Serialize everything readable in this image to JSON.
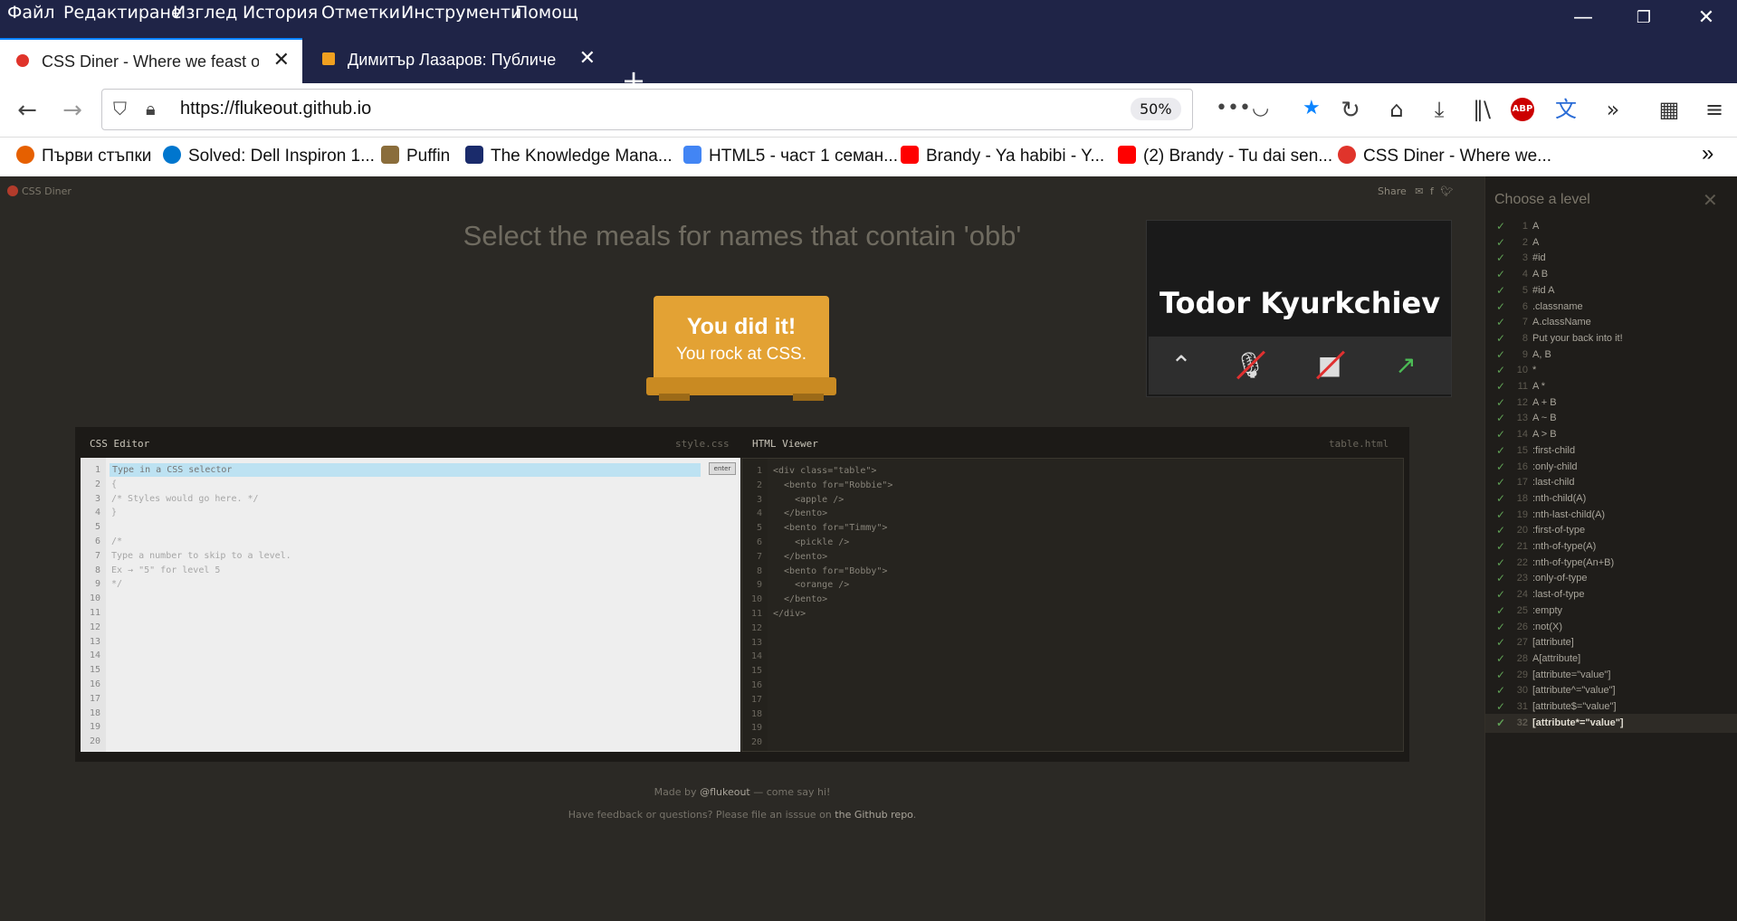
{
  "menubar": {
    "items": [
      "Файл",
      "Редактиране",
      "Изглед",
      "История",
      "Отметки",
      "Инструменти",
      "Помощ"
    ],
    "window_controls": [
      "—",
      "❐",
      "✕"
    ]
  },
  "tabs": [
    {
      "title": "CSS Diner - Where we feast on",
      "active": true
    },
    {
      "title": "Димитър Лазаров: Публичен",
      "active": false
    }
  ],
  "navbar": {
    "url": "https://flukeout.github.io",
    "zoom": "50%"
  },
  "bookmarks": [
    {
      "label": "Първи стъпки",
      "color": "#e66000"
    },
    {
      "label": "Solved: Dell Inspiron 1...",
      "color": "#0076ce"
    },
    {
      "label": "Puffin",
      "color": "#8a6d3b"
    },
    {
      "label": "The Knowledge Mana...",
      "color": "#1a2b6b"
    },
    {
      "label": "HTML5 - част 1 семан...",
      "color": "#4285f4"
    },
    {
      "label": "Brandy - Ya habibi - Y...",
      "color": "#ff0000"
    },
    {
      "label": "(2) Brandy - Tu dai sen...",
      "color": "#ff0000"
    },
    {
      "label": "CSS Diner - Where we...",
      "color": "#e0342b"
    }
  ],
  "page": {
    "logo": "CSS Diner",
    "share": "Share",
    "instruction": "Select the meals for names that contain 'obb'",
    "success_title": "You did it!",
    "success_sub": "You rock at CSS.",
    "video_name": "Todor Kyurkchiev",
    "css_editor_title": "CSS Editor",
    "css_editor_file": "style.css",
    "html_viewer_title": "HTML Viewer",
    "html_viewer_file": "table.html",
    "css_placeholder": "Type in a CSS selector",
    "enter_label": "enter",
    "footer_made_by": "Made by",
    "footer_author": "@flukeout",
    "footer_say_hi": "— come say hi!",
    "footer_feedback": "Have feedback or questions? Please file an isssue on",
    "footer_repo": "the Github repo",
    "footer_period": "."
  },
  "css_code": [
    "",
    "{",
    "/* Styles would go here. */",
    "}",
    "",
    "/*",
    "Type a number to skip to a level.",
    "Ex → \"5\" for level 5",
    "*/",
    "",
    "",
    "",
    "",
    "",
    "",
    "",
    "",
    "",
    "",
    ""
  ],
  "html_code": [
    "<div class=\"table\">",
    "  <bento for=\"Robbie\">",
    "    <apple />",
    "  </bento>",
    "  <bento for=\"Timmy\">",
    "    <pickle />",
    "  </bento>",
    "  <bento for=\"Bobby\">",
    "    <orange />",
    "  </bento>",
    "</div>",
    "",
    "",
    "",
    "",
    "",
    "",
    "",
    "",
    ""
  ],
  "levels_panel": {
    "title": "Choose a level",
    "levels": [
      "A",
      "A",
      "#id",
      "A B",
      "#id A",
      ".classname",
      "A.className",
      "Put your back into it!",
      "A, B",
      "*",
      "A *",
      "A + B",
      "A ~ B",
      "A > B",
      ":first-child",
      ":only-child",
      ":last-child",
      ":nth-child(A)",
      ":nth-last-child(A)",
      ":first-of-type",
      ":nth-of-type(A)",
      ":nth-of-type(An+B)",
      ":only-of-type",
      ":last-of-type",
      ":empty",
      ":not(X)",
      "[attribute]",
      "A[attribute]",
      "[attribute=\"value\"]",
      "[attribute^=\"value\"]",
      "[attribute$=\"value\"]",
      "[attribute*=\"value\"]"
    ],
    "current_level": 32
  }
}
